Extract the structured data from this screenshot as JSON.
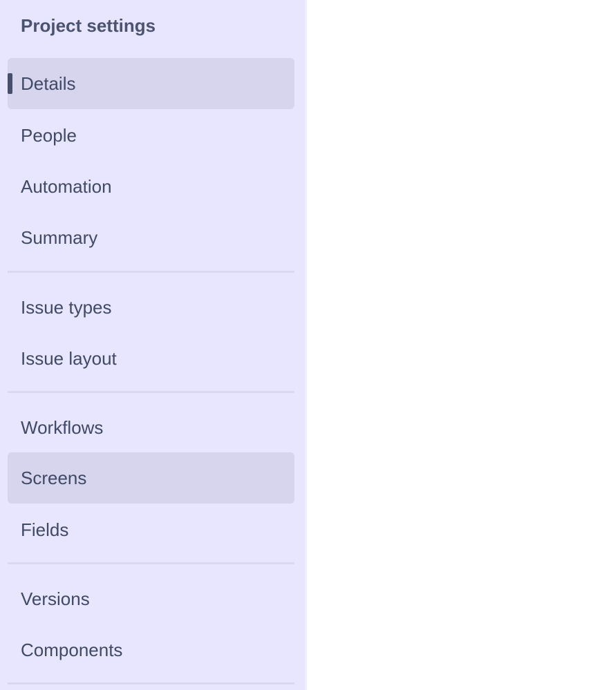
{
  "sidebar": {
    "title": "Project settings",
    "items": [
      {
        "label": "Details",
        "state": "active"
      },
      {
        "label": "People",
        "state": "default"
      },
      {
        "label": "Automation",
        "state": "default"
      },
      {
        "label": "Summary",
        "state": "default"
      },
      {
        "label": "Issue types",
        "state": "default"
      },
      {
        "label": "Issue layout",
        "state": "default"
      },
      {
        "label": "Workflows",
        "state": "default"
      },
      {
        "label": "Screens",
        "state": "hover"
      },
      {
        "label": "Fields",
        "state": "default"
      },
      {
        "label": "Versions",
        "state": "default"
      },
      {
        "label": "Components",
        "state": "default"
      }
    ]
  },
  "colors": {
    "sidebar_background": "#e8e6fe",
    "item_highlight": "#d6d5ed",
    "active_indicator": "#45506c",
    "text": "#3f4a66"
  }
}
